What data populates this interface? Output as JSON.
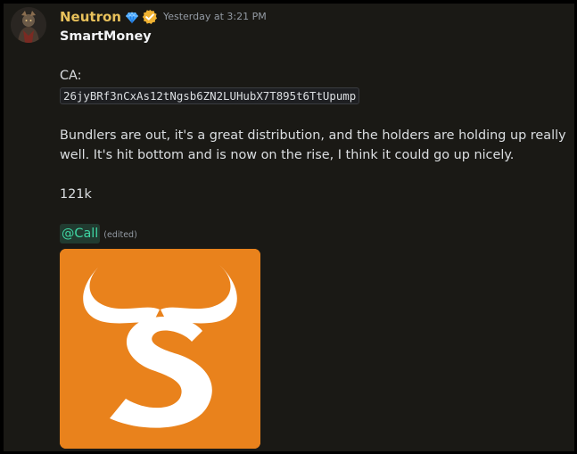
{
  "message": {
    "author": {
      "name": "Neutron",
      "name_color": "#e8c15b",
      "avatar_icon": "avatar-image",
      "badge_icons": [
        "gem-icon",
        "verified-icon"
      ]
    },
    "timestamp": "Yesterday at 3:21 PM",
    "lines": {
      "title": "SmartMoney",
      "ca_label": "CA:",
      "ca_code": "26jyBRf3nCxAs12tNgsb6ZN2LUHubX7T895t6TtUpump",
      "paragraph": "Bundlers are out, it's a great distribution, and the holders are holding up really well. It's hit bottom and is now on the rise, I think it could go up nicely.",
      "amount": "121k",
      "mention": "@Call",
      "edited": "(edited)"
    },
    "attachment": {
      "type": "image",
      "icon": "bull-s-logo",
      "background": "#e9821c"
    }
  }
}
